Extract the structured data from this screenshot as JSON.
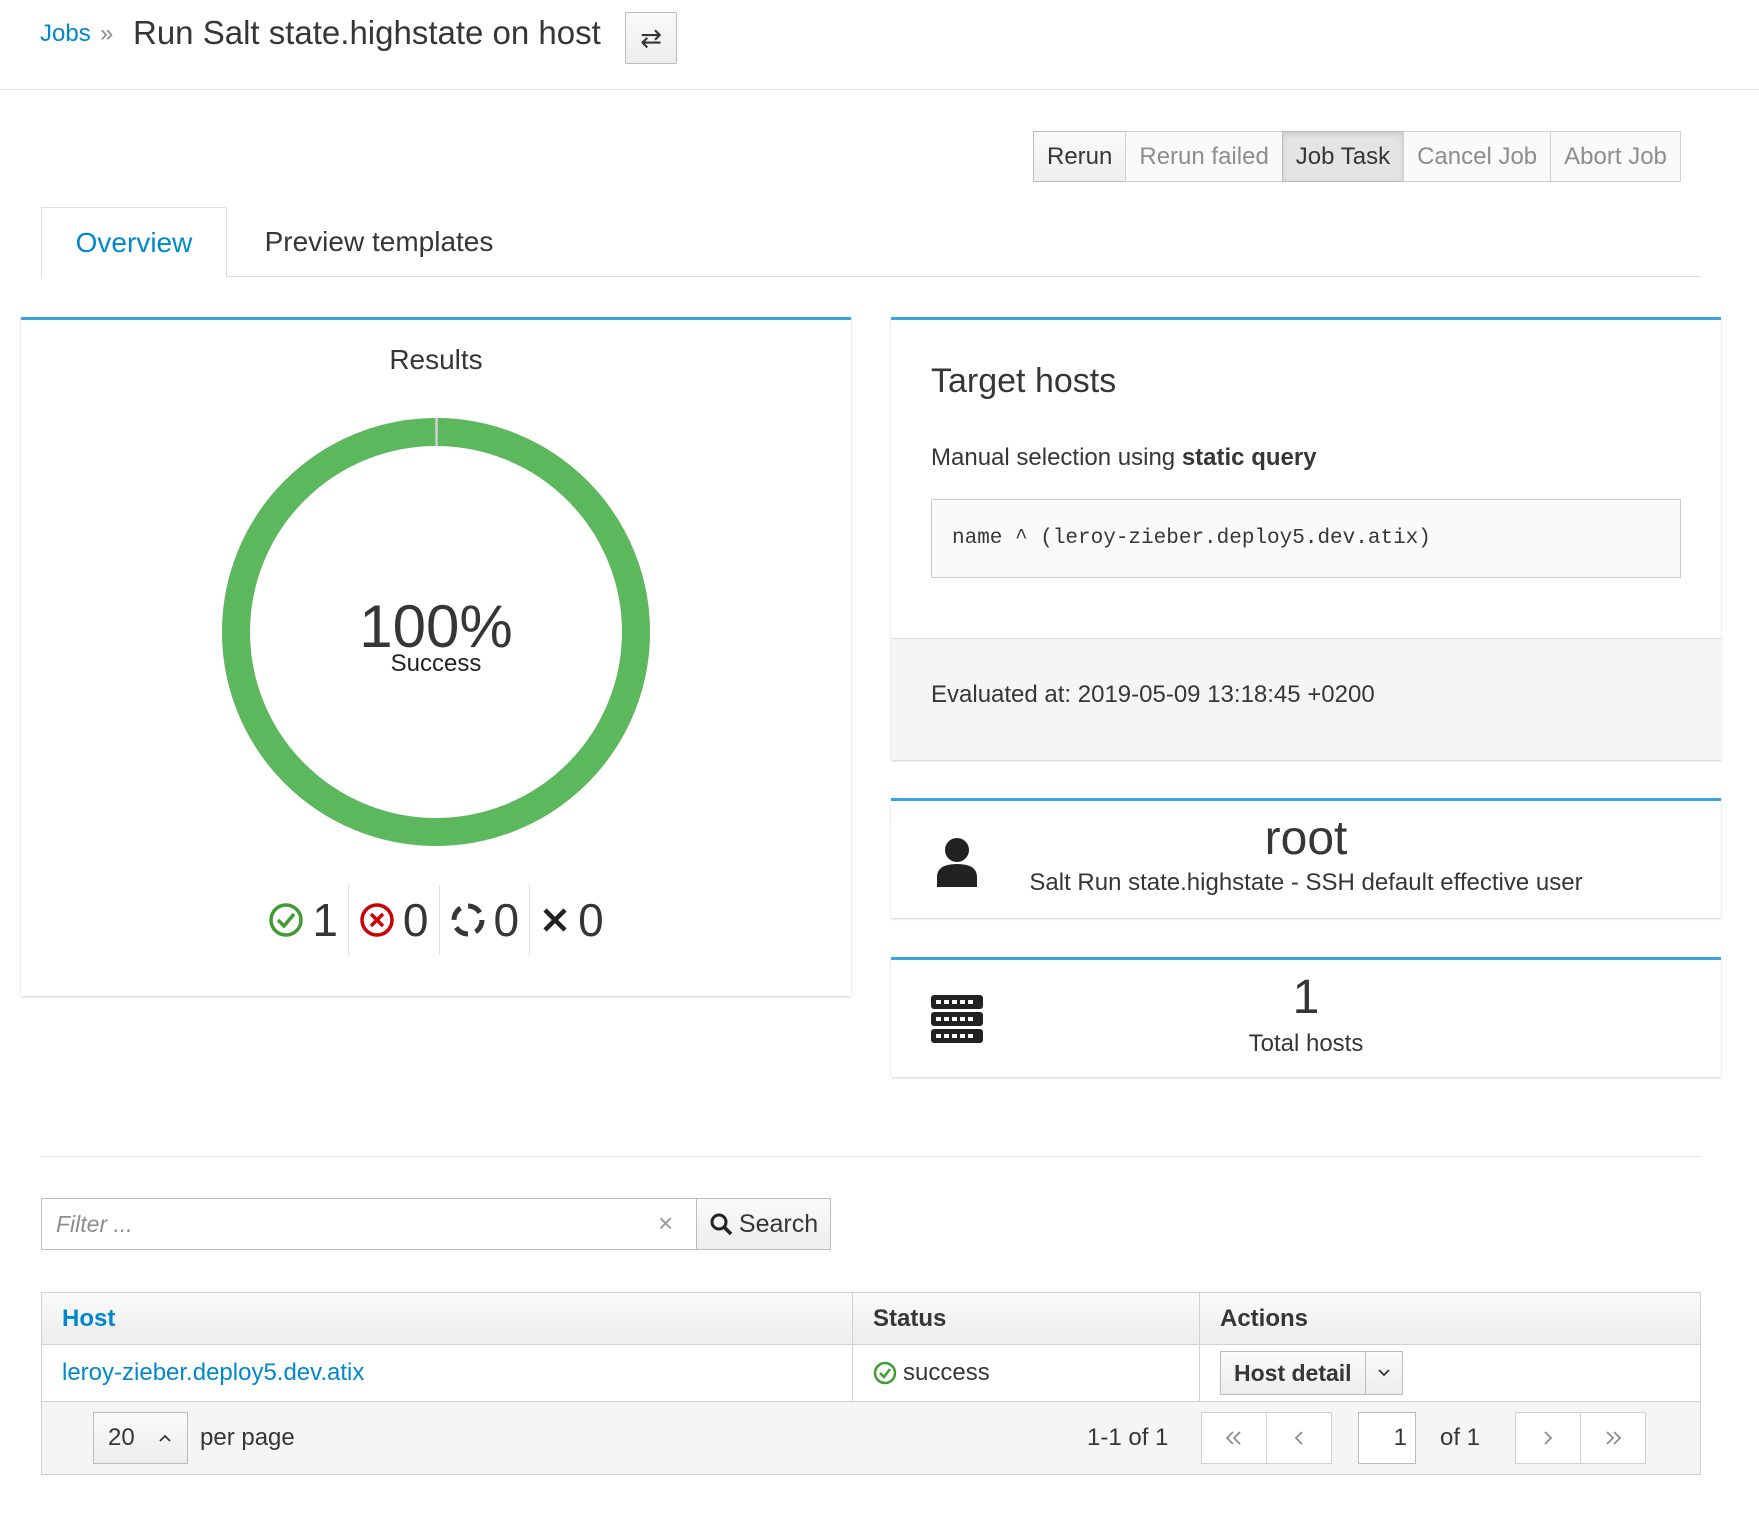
{
  "breadcrumb": {
    "parent": "Jobs",
    "separator": "»",
    "title": "Run Salt state.highstate on host"
  },
  "actions": {
    "rerun": "Rerun",
    "rerun_failed": "Rerun failed",
    "job_task": "Job Task",
    "cancel_job": "Cancel Job",
    "abort_job": "Abort Job"
  },
  "tabs": {
    "overview": "Overview",
    "preview": "Preview templates"
  },
  "results": {
    "title": "Results",
    "percent": "100%",
    "percent_label": "Success",
    "success_fraction": 1.0,
    "counts": {
      "success": "1",
      "failed": "0",
      "pending": "0",
      "cancelled": "0"
    },
    "colors": {
      "success": "#5cb85c",
      "failed": "#cc0000",
      "pending": "#363636"
    }
  },
  "target": {
    "title": "Target hosts",
    "desc_prefix": "Manual selection using",
    "desc_bold": "static query",
    "query": "name ^ (leroy-zieber.deploy5.dev.atix)",
    "evaluated": "Evaluated at: 2019-05-09 13:18:45 +0200"
  },
  "user": {
    "name": "root",
    "desc": "Salt Run state.highstate - SSH default effective user",
    "icon": "user-icon"
  },
  "hosts_summary": {
    "count": "1",
    "label": "Total hosts",
    "icon": "server-icon"
  },
  "search": {
    "placeholder": "Filter ...",
    "button": "Search"
  },
  "table": {
    "headers": {
      "host": "Host",
      "status": "Status",
      "actions": "Actions"
    },
    "rows": [
      {
        "host": "leroy-zieber.deploy5.dev.atix",
        "status": "success",
        "action": "Host detail"
      }
    ]
  },
  "pagination": {
    "per_page": "20",
    "per_page_label": "per page",
    "range": "1-1 of  1",
    "page": "1",
    "of": "of  1"
  }
}
